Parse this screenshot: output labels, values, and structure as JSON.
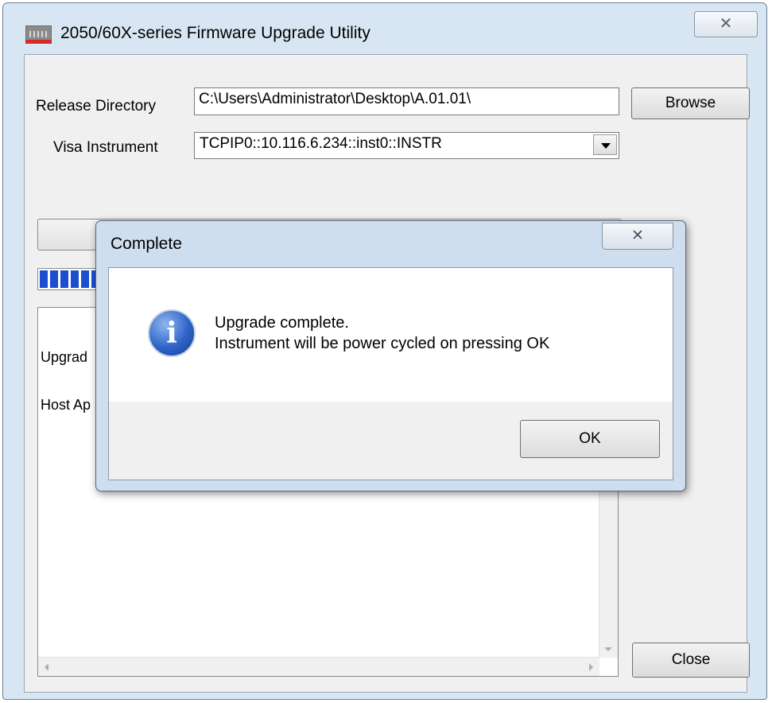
{
  "window": {
    "title": "2050/60X-series Firmware Upgrade Utility",
    "close_glyph": "✕",
    "app_icon": "app-icon"
  },
  "form": {
    "release_directory_label": "Release Directory",
    "release_directory_value": "C:\\Users\\Administrator\\Desktop\\A.01.01\\",
    "browse_label": "Browse",
    "visa_instrument_label": "Visa Instrument",
    "visa_instrument_value": "TCPIP0::10.116.6.234::inst0::INSTR",
    "close_label": "Close"
  },
  "progress": {
    "percent": 11
  },
  "log": {
    "lines": [
      "Upgrad",
      "Host Ap"
    ]
  },
  "dialog": {
    "title": "Complete",
    "close_glyph": "✕",
    "icon": "info-icon",
    "message_line1": "Upgrade complete.",
    "message_line2": "Instrument will be power cycled on pressing OK",
    "ok_label": "OK"
  }
}
